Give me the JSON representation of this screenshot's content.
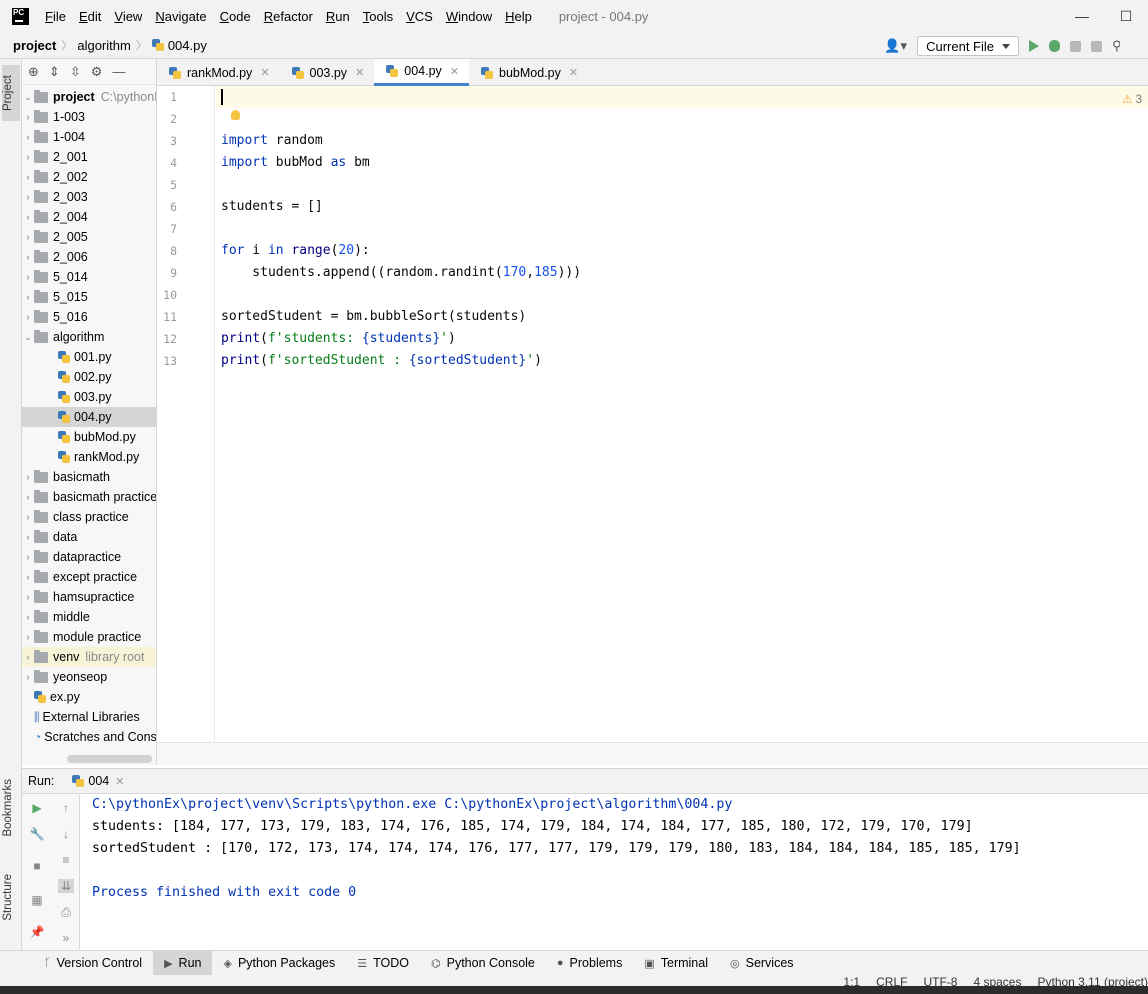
{
  "menubar": {
    "logo": "PC",
    "items": [
      {
        "label": "File",
        "mnemonic": "F",
        "rest": "ile"
      },
      {
        "label": "Edit",
        "mnemonic": "E",
        "rest": "dit"
      },
      {
        "label": "View",
        "mnemonic": "V",
        "rest": "iew"
      },
      {
        "label": "Navigate",
        "mnemonic": "N",
        "rest": "avigate"
      },
      {
        "label": "Code",
        "mnemonic": "C",
        "rest": "ode"
      },
      {
        "label": "Refactor",
        "mnemonic": "R",
        "rest": "efactor"
      },
      {
        "label": "Run",
        "mnemonic": "R",
        "rest": "un"
      },
      {
        "label": "Tools",
        "mnemonic": "T",
        "rest": "ools"
      },
      {
        "label": "VCS",
        "mnemonic": "V",
        "rest": "CS"
      },
      {
        "label": "Window",
        "mnemonic": "W",
        "rest": "indow"
      },
      {
        "label": "Help",
        "mnemonic": "H",
        "rest": "elp"
      }
    ],
    "window_title": "project - 004.py",
    "minimize": "—",
    "maximize": "☐"
  },
  "navbar": {
    "breadcrumb": [
      "project",
      "algorithm",
      "004.py"
    ],
    "run_config": "Current File"
  },
  "side_labels": {
    "project": "Project",
    "bookmarks": "Bookmarks",
    "structure": "Structure"
  },
  "project_tree": {
    "root_name": "project",
    "root_path": "C:\\pythonEx",
    "folders_top": [
      "1-003",
      "1-004",
      "2_001",
      "2_002",
      "2_003",
      "2_004",
      "2_005",
      "2_006",
      "5_014",
      "5_015",
      "5_016"
    ],
    "open_folder": "algorithm",
    "files": [
      "001.py",
      "002.py",
      "003.py",
      "004.py",
      "bubMod.py",
      "rankMod.py"
    ],
    "selected_file": "004.py",
    "folders_bottom": [
      "basicmath",
      "basicmath practice",
      "class practice",
      "data",
      "datapractice",
      "except practice",
      "hamsupractice",
      "middle",
      "module practice"
    ],
    "venv": "venv",
    "venv_note": "library root",
    "folder_last": "yeonseop",
    "root_file": "ex.py",
    "external_libraries": "External Libraries",
    "scratches": "Scratches and Consoles"
  },
  "editor_tabs": [
    {
      "label": "rankMod.py",
      "active": false
    },
    {
      "label": "003.py",
      "active": false
    },
    {
      "label": "004.py",
      "active": true
    },
    {
      "label": "bubMod.py",
      "active": false
    }
  ],
  "editor": {
    "line_numbers": [
      "1",
      "2",
      "3",
      "4",
      "5",
      "6",
      "7",
      "8",
      "9",
      "10",
      "11",
      "12",
      "13"
    ],
    "warning_count": "3",
    "code": {
      "l3_kw": "import",
      "l3_rest": " random",
      "l4_kw": "import",
      "l4_mod": " bubMod ",
      "l4_as": "as",
      "l4_alias": " bm",
      "l6": "students = []",
      "l8_kw1": "for",
      "l8_mid": " i ",
      "l8_kw2": "in",
      "l8_sp": " ",
      "l8_range": "range",
      "l8_open": "(",
      "l8_num": "20",
      "l8_close": "):",
      "l9_pre": "    students.append((random.randint(",
      "l9_n1": "170",
      "l9_comma": ",",
      "l9_n2": "185",
      "l9_post": ")))",
      "l11": "sortedStudent = bm.bubbleSort(students)",
      "l12_print": "print",
      "l12_open": "(",
      "l12_s1": "f'students: ",
      "l12_expr": "{students}",
      "l12_s2": "'",
      "l12_close": ")",
      "l13_print": "print",
      "l13_open": "(",
      "l13_s1": "f'sortedStudent : ",
      "l13_expr": "{sortedStudent}",
      "l13_s2": "'",
      "l13_close": ")"
    }
  },
  "run_panel": {
    "label": "Run:",
    "tab": "004"
  },
  "console": {
    "command": "C:\\pythonEx\\project\\venv\\Scripts\\python.exe C:\\pythonEx\\project\\algorithm\\004.py",
    "line1": "students: [184, 177, 173, 179, 183, 174, 176, 185, 174, 179, 184, 174, 184, 177, 185, 180, 172, 179, 170, 179]",
    "line2": "sortedStudent : [170, 172, 173, 174, 174, 174, 176, 177, 177, 179, 179, 179, 180, 183, 184, 184, 184, 185, 185, 179]",
    "exit": "Process finished with exit code 0"
  },
  "bottom_tabs": [
    {
      "label": "Version Control",
      "icon": "branch-icon"
    },
    {
      "label": "Run",
      "icon": "play-icon",
      "active": true
    },
    {
      "label": "Python Packages",
      "icon": "packages-icon"
    },
    {
      "label": "TODO",
      "icon": "list-icon"
    },
    {
      "label": "Python Console",
      "icon": "python-console-icon"
    },
    {
      "label": "Problems",
      "icon": "problems-icon"
    },
    {
      "label": "Terminal",
      "icon": "terminal-icon"
    },
    {
      "label": "Services",
      "icon": "services-icon"
    }
  ],
  "statusbar": {
    "position": "1:1",
    "line_sep": "CRLF",
    "encoding": "UTF-8",
    "indent": "4 spaces",
    "interpreter": "Python 3.11 (project)"
  },
  "colors": {
    "keyword": "#0033b3",
    "number": "#1750eb",
    "string": "#067d17",
    "run_green": "#59a869",
    "active_tab": "#4083c9"
  }
}
